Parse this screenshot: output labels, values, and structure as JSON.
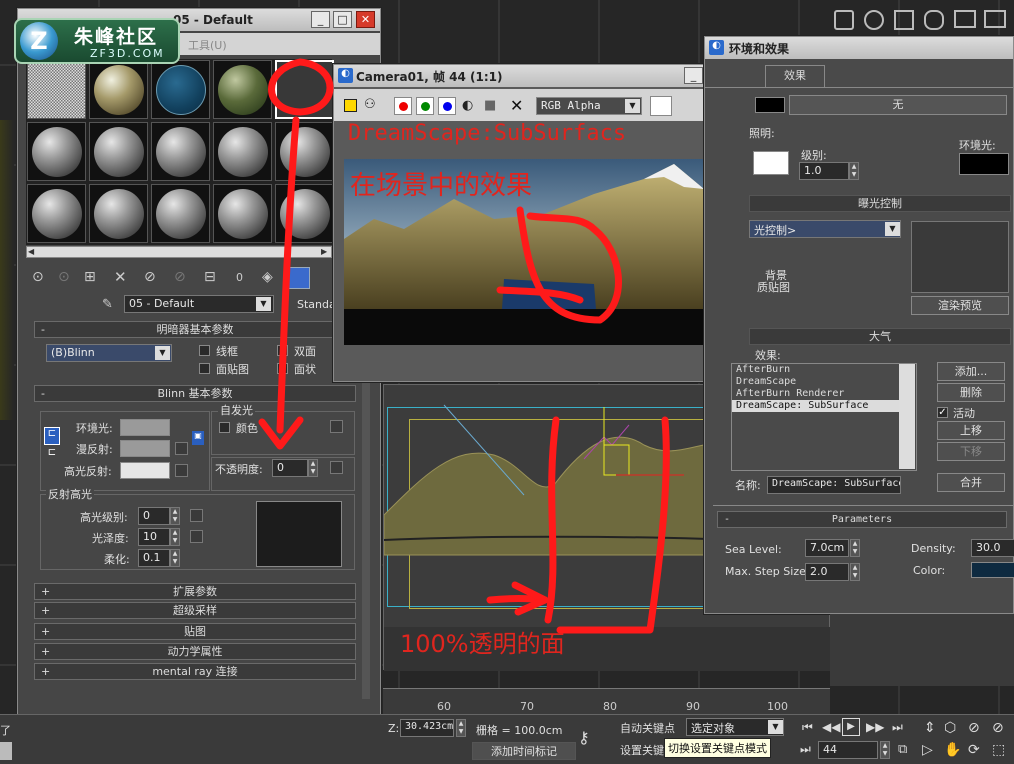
{
  "logo": {
    "main": "朱峰社区",
    "sub": "ZF3D.COM"
  },
  "material_editor": {
    "title": "材质编辑器 - 05 - Default",
    "title_visible": "05 - Default",
    "menu_tools": "工具(U)",
    "material_name": "05 - Default",
    "material_type": "Standa",
    "rollouts": {
      "shader_basic": "明暗器基本参数",
      "blinn_basic": "Blinn 基本参数",
      "extended": "扩展参数",
      "supersampling": "超级采样",
      "maps": "贴图",
      "dynamics": "动力学属性",
      "mental_ray": "mental ray 连接"
    },
    "shader": "(B)Blinn",
    "checks": {
      "wire": "线框",
      "two_sided": "双面",
      "face_map": "面贴图",
      "faceted": "面状"
    },
    "self_illum": "自发光",
    "color_label": "颜色",
    "self_illum_value": "0",
    "ambient": "环境光:",
    "diffuse": "漫反射:",
    "specular": "高光反射:",
    "opacity_label": "不透明度:",
    "opacity_value": "0",
    "spec_highlights": "反射高光",
    "spec_level_label": "高光级别:",
    "spec_level": "0",
    "glossiness_label": "光泽度:",
    "glossiness": "10",
    "soften_label": "柔化:",
    "soften": "0.1"
  },
  "camera_window": {
    "title": "Camera01, 帧 44 (1:1)",
    "channel": "RGB Alpha",
    "overlay_title": "DreamScape:SubSurfacs",
    "annotation": "在场景中的效果"
  },
  "viewport": {
    "annotation": "100%透明的面"
  },
  "env_effects": {
    "title": "环境和效果",
    "tab_effects": "效果",
    "none_label": "无",
    "lighting": "照明:",
    "ambient": "环境光:",
    "level_label": "级别:",
    "level": "1.0",
    "exposure_rollout": "曝光控制",
    "exposure_control": "光控制>",
    "render_preview": "渲染预览",
    "atmosphere_rollout": "大气",
    "effects_label": "效果:",
    "effects_list": [
      "AfterBurn",
      "DreamScape",
      "AfterBurn Renderer",
      "DreamScape: SubSurface"
    ],
    "add": "添加...",
    "delete": "删除",
    "active": "活动",
    "move_up": "上移",
    "move_down": "下移",
    "name_label": "名称:",
    "name_value": "DreamScape: SubSurface",
    "merge": "合并",
    "params_rollout": "Parameters",
    "sea_level_label": "Sea Level:",
    "sea_level": "7.0cm",
    "max_step_label": "Max. Step Size:",
    "max_step": "2.0",
    "density_label": "Density:",
    "density": "30.0",
    "color_label": "Color:",
    "bg_labels": [
      "背景",
      "质贴图"
    ]
  },
  "timeline": {
    "ticks": [
      "60",
      "70",
      "80",
      "90",
      "100"
    ]
  },
  "status_bar": {
    "z_label": "Z:",
    "z_value": "30.423cm",
    "grid": "栅格 = 100.0cm",
    "auto_key": "自动关键点",
    "selected": "选定对象",
    "set_key": "设置关键",
    "tooltip": "切换设置关键点模式",
    "add_time_tag": "添加时间标记",
    "frame": "44",
    "left_label": "了"
  }
}
